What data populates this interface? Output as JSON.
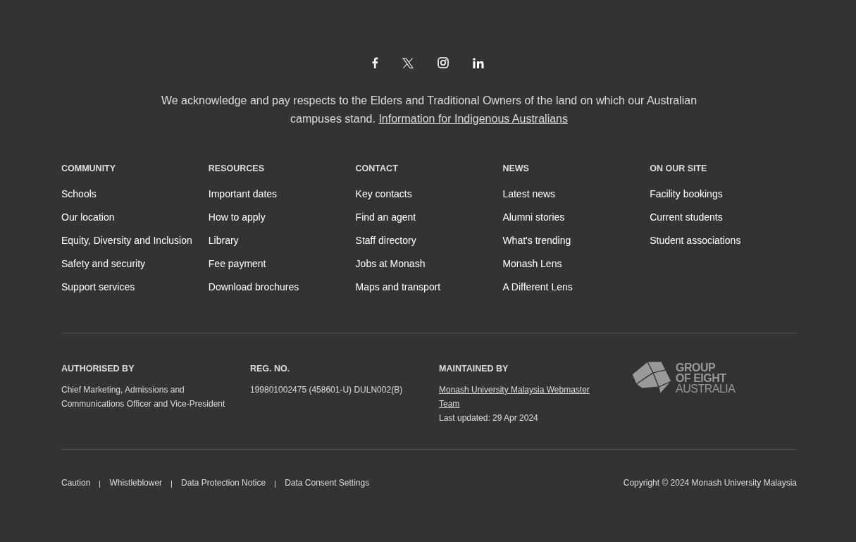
{
  "social_links": [
    {
      "kind": "facebook"
    },
    {
      "kind": "x"
    },
    {
      "kind": "instagram"
    },
    {
      "kind": "linkedin"
    }
  ],
  "acknowledgement": {
    "text": "We acknowledge and pay respects to the Elders and Traditional Owners of the land on which our Australian campuses stand.",
    "link": "Information for Indigenous Australians"
  },
  "link_columns": [
    {
      "heading": "COMMUNITY",
      "links": [
        "Schools",
        "Our location",
        "Equity, Diversity and Inclusion",
        "Safety and security",
        "Support services"
      ]
    },
    {
      "heading": "RESOURCES",
      "links": [
        "Important dates",
        "How to apply",
        "Library",
        "Fee payment",
        "Download brochures"
      ]
    },
    {
      "heading": "CONTACT",
      "links": [
        "Key contacts",
        "Find an agent",
        "Staff directory",
        "Jobs at Monash",
        "Maps and transport"
      ]
    },
    {
      "heading": "NEWS",
      "links": [
        "Latest news",
        "Alumni stories",
        "What's trending",
        "Monash Lens",
        "A Different Lens"
      ]
    },
    {
      "heading": "ON OUR SITE",
      "links": [
        "Facility bookings",
        "Current students",
        "Student associations"
      ]
    }
  ],
  "info": {
    "authorised": {
      "heading": "AUTHORISED BY",
      "text": "Chief Marketing, Admissions and Communications Officer and Vice-President"
    },
    "reg": {
      "heading": "REG. NO.",
      "text": "199801002475 (458601-U) DULN002(B)"
    },
    "maintained": {
      "heading": "MAINTAINED BY",
      "link": "Monash University Malaysia Webmaster Team",
      "updated": "Last updated: 29 Apr 2024"
    }
  },
  "logo": {
    "lines": [
      "GROUP",
      "OF EIGHT",
      "AUSTRALIA"
    ]
  },
  "legal_links": [
    "Caution",
    "Whistleblower",
    "Data Protection Notice",
    "Data Consent Settings"
  ],
  "copyright": "Copyright © 2024 Monash University Malaysia"
}
